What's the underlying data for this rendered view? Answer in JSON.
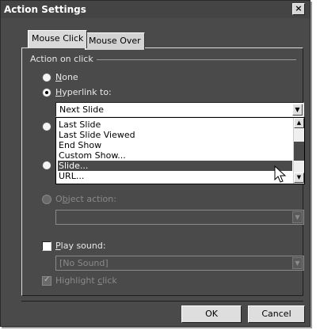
{
  "window": {
    "title": "Action Settings",
    "close_glyph": "×"
  },
  "tabs": [
    {
      "label": "Mouse Click",
      "active": true
    },
    {
      "label": "Mouse Over",
      "active": false
    }
  ],
  "group": {
    "label": "Action on click"
  },
  "options": {
    "none": {
      "prefix": "",
      "key": "N",
      "rest": "one"
    },
    "hyperlink": {
      "prefix": "",
      "key": "H",
      "rest": "yperlink to:"
    },
    "object_action": {
      "prefix": "O",
      "key": "b",
      "rest": "ject action:"
    }
  },
  "hyperlink_combo": {
    "value": "Next Slide"
  },
  "dropdown": {
    "items": [
      "Last Slide",
      "Last Slide Viewed",
      "End Show",
      "Custom Show...",
      "Slide...",
      "URL..."
    ],
    "selected_index": 4
  },
  "play_sound": {
    "key": "P",
    "rest": "lay sound:",
    "checked": false
  },
  "sound_combo": {
    "value": "[No Sound]"
  },
  "highlight_click": {
    "prefix": "Highlight ",
    "key": "c",
    "rest": "lick",
    "checked": true
  },
  "buttons": {
    "ok": "OK",
    "cancel": "Cancel"
  },
  "icons": {
    "dropdown_arrow": "▼",
    "scroll_up": "▲",
    "scroll_down": "▼",
    "check": "✓"
  },
  "colors": {
    "face": "#4a4a4a",
    "window_bg": "#ffffff",
    "selection": "#4a4a4a"
  }
}
